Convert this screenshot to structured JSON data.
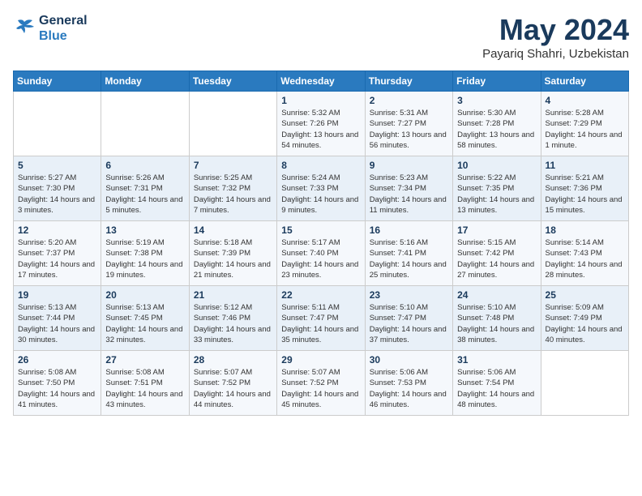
{
  "header": {
    "logo_line1": "General",
    "logo_line2": "Blue",
    "month_title": "May 2024",
    "subtitle": "Payariq Shahri, Uzbekistan"
  },
  "days_of_week": [
    "Sunday",
    "Monday",
    "Tuesday",
    "Wednesday",
    "Thursday",
    "Friday",
    "Saturday"
  ],
  "weeks": [
    [
      {
        "day": "",
        "info": ""
      },
      {
        "day": "",
        "info": ""
      },
      {
        "day": "",
        "info": ""
      },
      {
        "day": "1",
        "info": "Sunrise: 5:32 AM\nSunset: 7:26 PM\nDaylight: 13 hours and 54 minutes."
      },
      {
        "day": "2",
        "info": "Sunrise: 5:31 AM\nSunset: 7:27 PM\nDaylight: 13 hours and 56 minutes."
      },
      {
        "day": "3",
        "info": "Sunrise: 5:30 AM\nSunset: 7:28 PM\nDaylight: 13 hours and 58 minutes."
      },
      {
        "day": "4",
        "info": "Sunrise: 5:28 AM\nSunset: 7:29 PM\nDaylight: 14 hours and 1 minute."
      }
    ],
    [
      {
        "day": "5",
        "info": "Sunrise: 5:27 AM\nSunset: 7:30 PM\nDaylight: 14 hours and 3 minutes."
      },
      {
        "day": "6",
        "info": "Sunrise: 5:26 AM\nSunset: 7:31 PM\nDaylight: 14 hours and 5 minutes."
      },
      {
        "day": "7",
        "info": "Sunrise: 5:25 AM\nSunset: 7:32 PM\nDaylight: 14 hours and 7 minutes."
      },
      {
        "day": "8",
        "info": "Sunrise: 5:24 AM\nSunset: 7:33 PM\nDaylight: 14 hours and 9 minutes."
      },
      {
        "day": "9",
        "info": "Sunrise: 5:23 AM\nSunset: 7:34 PM\nDaylight: 14 hours and 11 minutes."
      },
      {
        "day": "10",
        "info": "Sunrise: 5:22 AM\nSunset: 7:35 PM\nDaylight: 14 hours and 13 minutes."
      },
      {
        "day": "11",
        "info": "Sunrise: 5:21 AM\nSunset: 7:36 PM\nDaylight: 14 hours and 15 minutes."
      }
    ],
    [
      {
        "day": "12",
        "info": "Sunrise: 5:20 AM\nSunset: 7:37 PM\nDaylight: 14 hours and 17 minutes."
      },
      {
        "day": "13",
        "info": "Sunrise: 5:19 AM\nSunset: 7:38 PM\nDaylight: 14 hours and 19 minutes."
      },
      {
        "day": "14",
        "info": "Sunrise: 5:18 AM\nSunset: 7:39 PM\nDaylight: 14 hours and 21 minutes."
      },
      {
        "day": "15",
        "info": "Sunrise: 5:17 AM\nSunset: 7:40 PM\nDaylight: 14 hours and 23 minutes."
      },
      {
        "day": "16",
        "info": "Sunrise: 5:16 AM\nSunset: 7:41 PM\nDaylight: 14 hours and 25 minutes."
      },
      {
        "day": "17",
        "info": "Sunrise: 5:15 AM\nSunset: 7:42 PM\nDaylight: 14 hours and 27 minutes."
      },
      {
        "day": "18",
        "info": "Sunrise: 5:14 AM\nSunset: 7:43 PM\nDaylight: 14 hours and 28 minutes."
      }
    ],
    [
      {
        "day": "19",
        "info": "Sunrise: 5:13 AM\nSunset: 7:44 PM\nDaylight: 14 hours and 30 minutes."
      },
      {
        "day": "20",
        "info": "Sunrise: 5:13 AM\nSunset: 7:45 PM\nDaylight: 14 hours and 32 minutes."
      },
      {
        "day": "21",
        "info": "Sunrise: 5:12 AM\nSunset: 7:46 PM\nDaylight: 14 hours and 33 minutes."
      },
      {
        "day": "22",
        "info": "Sunrise: 5:11 AM\nSunset: 7:47 PM\nDaylight: 14 hours and 35 minutes."
      },
      {
        "day": "23",
        "info": "Sunrise: 5:10 AM\nSunset: 7:47 PM\nDaylight: 14 hours and 37 minutes."
      },
      {
        "day": "24",
        "info": "Sunrise: 5:10 AM\nSunset: 7:48 PM\nDaylight: 14 hours and 38 minutes."
      },
      {
        "day": "25",
        "info": "Sunrise: 5:09 AM\nSunset: 7:49 PM\nDaylight: 14 hours and 40 minutes."
      }
    ],
    [
      {
        "day": "26",
        "info": "Sunrise: 5:08 AM\nSunset: 7:50 PM\nDaylight: 14 hours and 41 minutes."
      },
      {
        "day": "27",
        "info": "Sunrise: 5:08 AM\nSunset: 7:51 PM\nDaylight: 14 hours and 43 minutes."
      },
      {
        "day": "28",
        "info": "Sunrise: 5:07 AM\nSunset: 7:52 PM\nDaylight: 14 hours and 44 minutes."
      },
      {
        "day": "29",
        "info": "Sunrise: 5:07 AM\nSunset: 7:52 PM\nDaylight: 14 hours and 45 minutes."
      },
      {
        "day": "30",
        "info": "Sunrise: 5:06 AM\nSunset: 7:53 PM\nDaylight: 14 hours and 46 minutes."
      },
      {
        "day": "31",
        "info": "Sunrise: 5:06 AM\nSunset: 7:54 PM\nDaylight: 14 hours and 48 minutes."
      },
      {
        "day": "",
        "info": ""
      }
    ]
  ]
}
